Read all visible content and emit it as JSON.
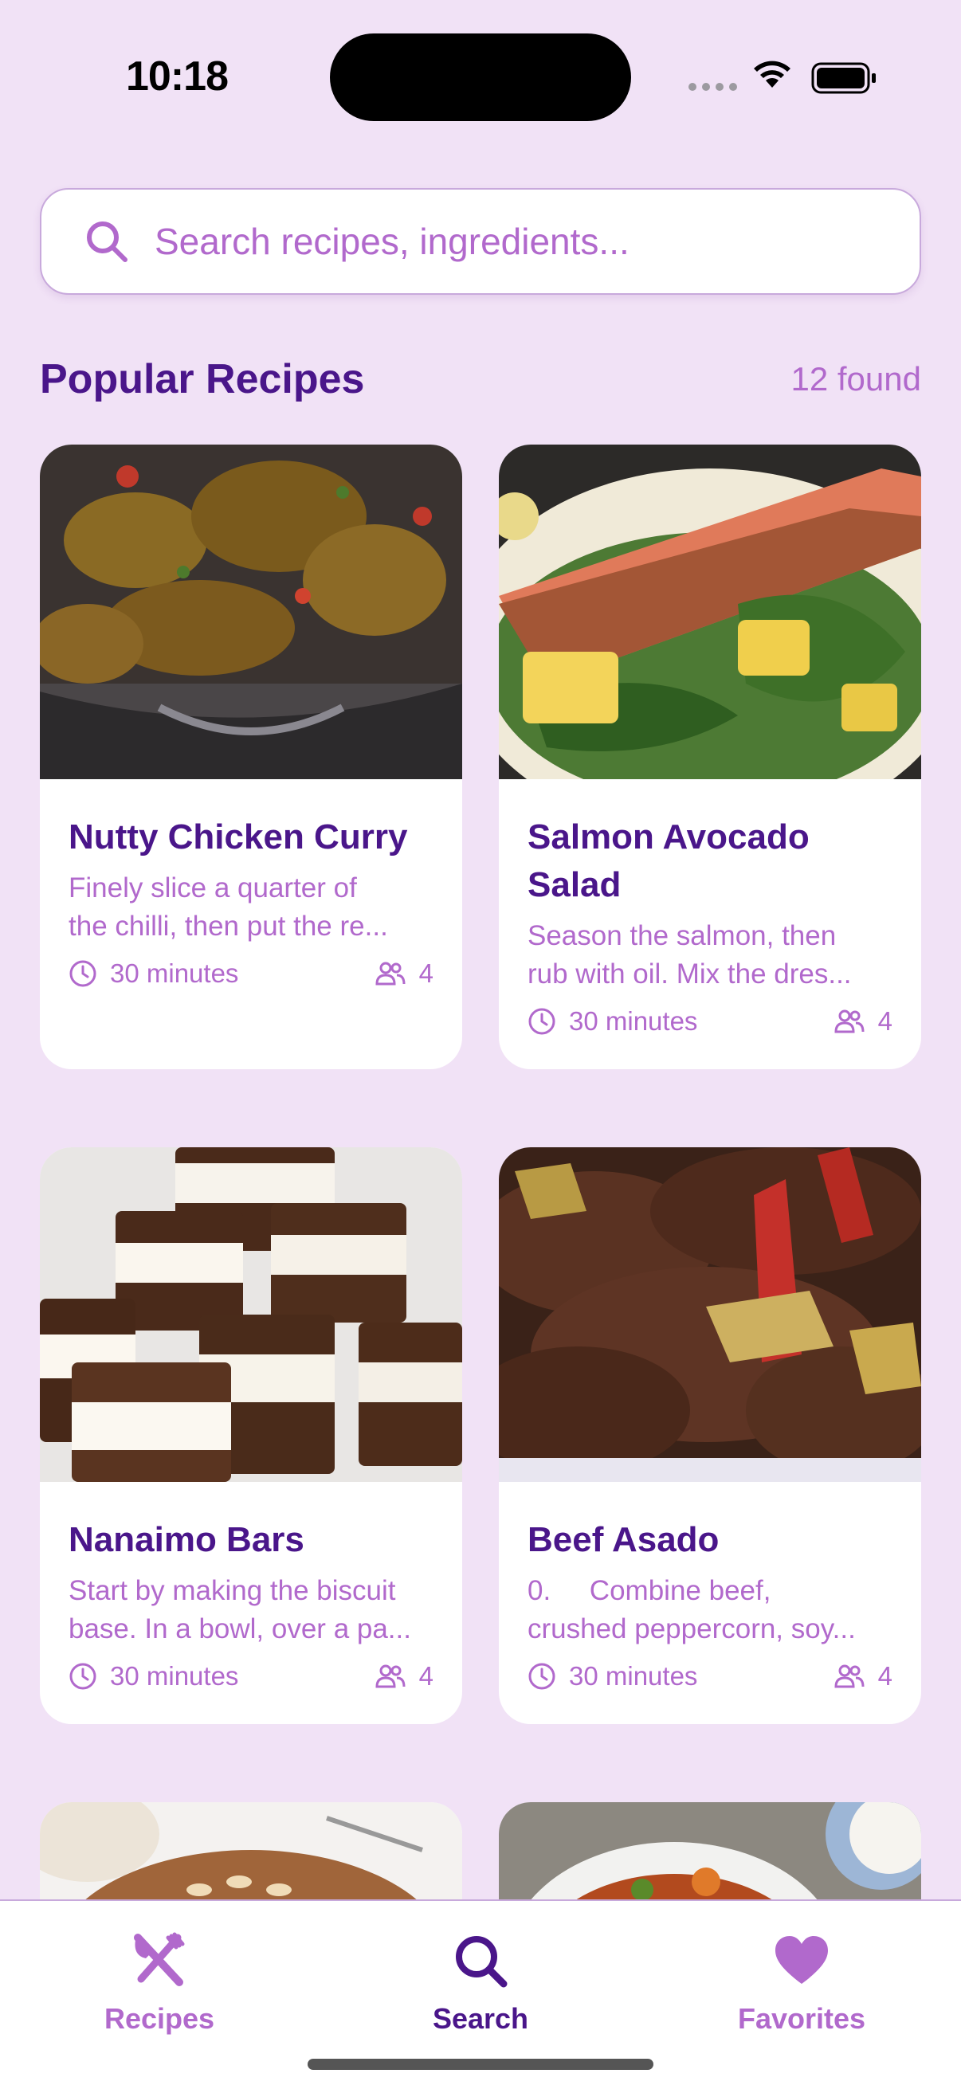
{
  "status_bar": {
    "time": "10:18"
  },
  "search": {
    "placeholder": "Search recipes, ingredients..."
  },
  "section": {
    "title": "Popular Recipes",
    "count": "12 found"
  },
  "recipes": [
    {
      "title": "Nutty Chicken Curry",
      "desc_line1": "Finely slice a quarter of",
      "desc_line2": "the chilli, then put the re...",
      "time": "30 minutes",
      "servings": "4"
    },
    {
      "title": "Salmon Avocado Salad",
      "desc_line1": "Season the salmon, then",
      "desc_line2": "rub with oil. Mix the dres...",
      "time": "30 minutes",
      "servings": "4"
    },
    {
      "title": "Nanaimo Bars",
      "desc_line1": "Start by making the biscuit",
      "desc_line2": "base. In a bowl, over a pa...",
      "time": "30 minutes",
      "servings": "4"
    },
    {
      "title": "Beef Asado",
      "desc_line1": "0.     Combine beef,",
      "desc_line2": "crushed peppercorn, soy...",
      "time": "30 minutes",
      "servings": "4"
    }
  ],
  "tabs": [
    {
      "label": "Recipes",
      "icon": "fork-knife-icon"
    },
    {
      "label": "Search",
      "icon": "search-icon"
    },
    {
      "label": "Favorites",
      "icon": "heart-icon"
    }
  ],
  "colors": {
    "background": "#f1e2f6",
    "accent": "#b169cc",
    "title": "#4a168a"
  }
}
